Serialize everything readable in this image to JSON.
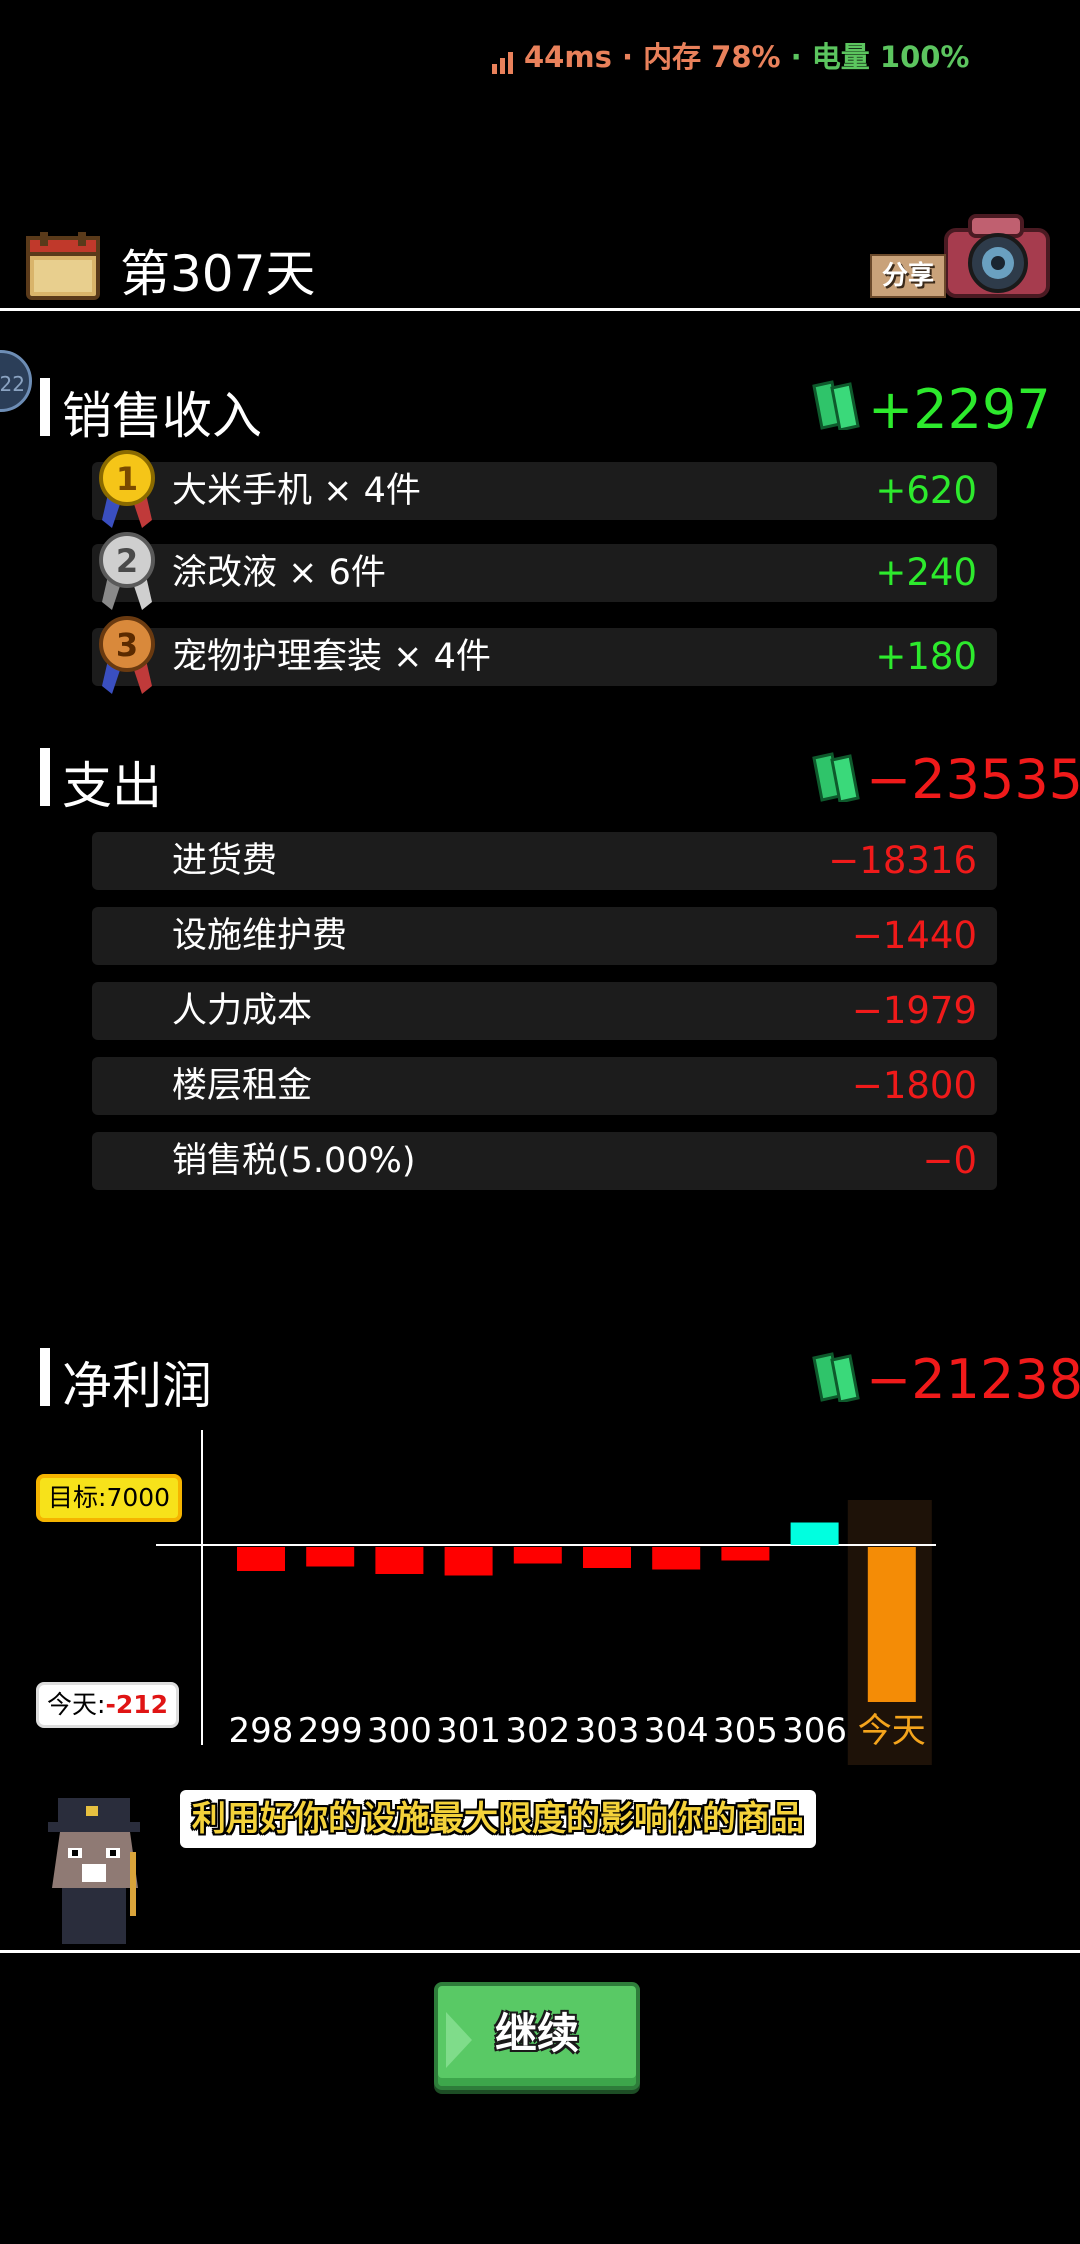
{
  "status": {
    "latency": "44ms",
    "sep1": " · ",
    "memory": "内存 78%",
    "sep2": " · ",
    "battery": "电量 100%",
    "signal_icon": "signal-bars-icon"
  },
  "header": {
    "day": "第307天",
    "share_label": "分享",
    "side_badge": "22"
  },
  "income": {
    "title": "销售收入",
    "total": "+2297",
    "items": [
      {
        "rank": "1",
        "label": "大米手机 × 4件",
        "value": "+620"
      },
      {
        "rank": "2",
        "label": "涂改液 × 6件",
        "value": "+240"
      },
      {
        "rank": "3",
        "label": "宠物护理套装 × 4件",
        "value": "+180"
      }
    ]
  },
  "expense": {
    "title": "支出",
    "total": "−23535",
    "items": [
      {
        "label": "进货费",
        "value": "−18316"
      },
      {
        "label": "设施维护费",
        "value": "−1440"
      },
      {
        "label": "人力成本",
        "value": "−1979"
      },
      {
        "label": "楼层租金",
        "value": "−1800"
      },
      {
        "label": "销售税(5.00%)",
        "value": "−0"
      }
    ]
  },
  "profit": {
    "title": "净利润",
    "total": "−21238"
  },
  "chart_labels": {
    "target_prefix": "目标:",
    "target_value": "7000",
    "today_prefix": "今天:",
    "today_value": "-212"
  },
  "chart_data": {
    "type": "bar",
    "categories": [
      "298",
      "299",
      "300",
      "301",
      "302",
      "303",
      "304",
      "305",
      "306",
      "今天"
    ],
    "values": [
      -16,
      -13,
      -18,
      -19,
      -11,
      -14,
      -15,
      -9,
      15,
      -212
    ],
    "target": 7000,
    "colors": {
      "negative": "#ff0000",
      "positive": "#00ffe0",
      "today": "#f48c06",
      "today_bg": "#1e1208"
    }
  },
  "tip": "利用好你的设施最大限度的影响你的商品",
  "continue_label": "继续",
  "colors": {
    "green": "#2dea2d",
    "red": "#f01a1a",
    "status_orange": "#e9815b",
    "status_green": "#5cc55f"
  }
}
